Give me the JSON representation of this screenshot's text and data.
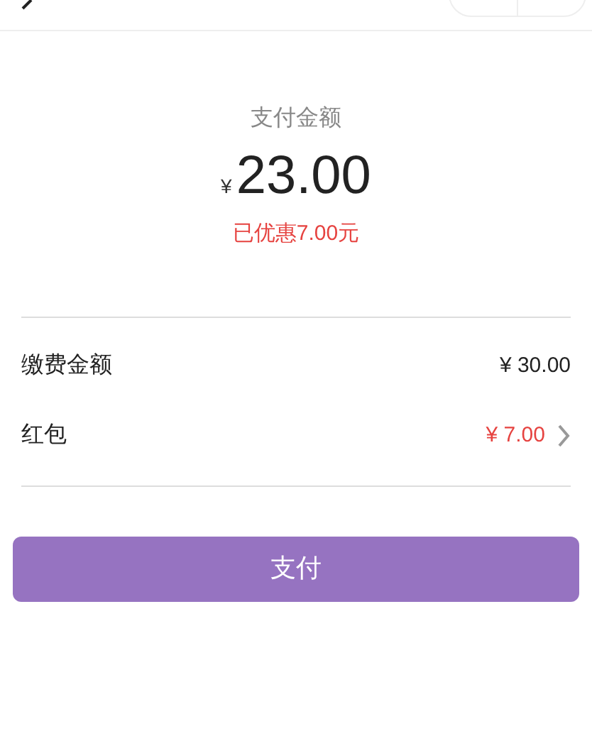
{
  "payment": {
    "label": "支付金额",
    "currency": "¥",
    "amount": "23.00",
    "discount": "已优惠7.00元"
  },
  "rows": [
    {
      "kind": "plain",
      "label": "缴费金额",
      "value": "¥ 30.00"
    },
    {
      "kind": "link",
      "label": "红包",
      "value": "¥ 7.00"
    }
  ],
  "button": "支付"
}
